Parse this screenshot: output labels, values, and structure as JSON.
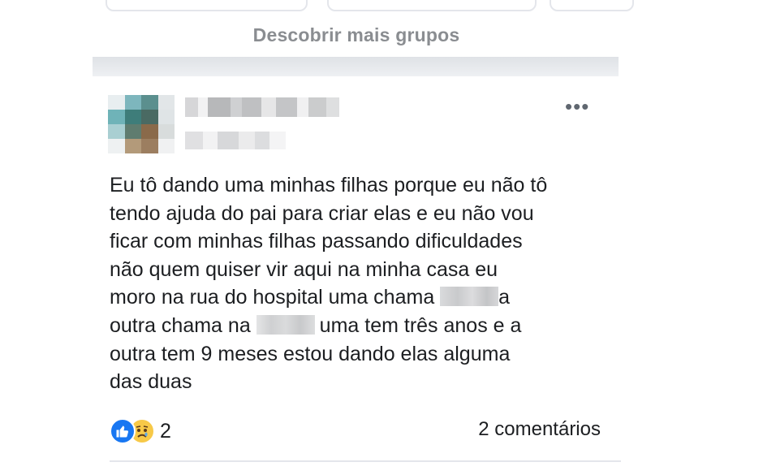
{
  "discover": {
    "label": "Descobrir mais grupos"
  },
  "post": {
    "more_label": "•••",
    "text": {
      "line1": "Eu tô dando uma minhas filhas porque eu não tô",
      "line2": "tendo ajuda do pai para criar elas e eu não vou",
      "line3": "ficar com minhas filhas passando dificuldades",
      "line4": "não quem quiser vir aqui na minha casa eu",
      "line5a": "moro na rua do hospital uma chama ",
      "line5b": "a",
      "line6a": "outra chama na ",
      "line6b": "uma tem três anos e a",
      "line7": "outra tem 9 meses estou dando elas alguma",
      "line8": "das duas"
    },
    "reactions": {
      "count": "2",
      "icons": [
        "like-icon",
        "sad-icon"
      ]
    },
    "comments_label": "2 comentários"
  },
  "colors": {
    "like": "#1877f2",
    "sad": "#f7c948",
    "muted": "#8a8d91"
  }
}
